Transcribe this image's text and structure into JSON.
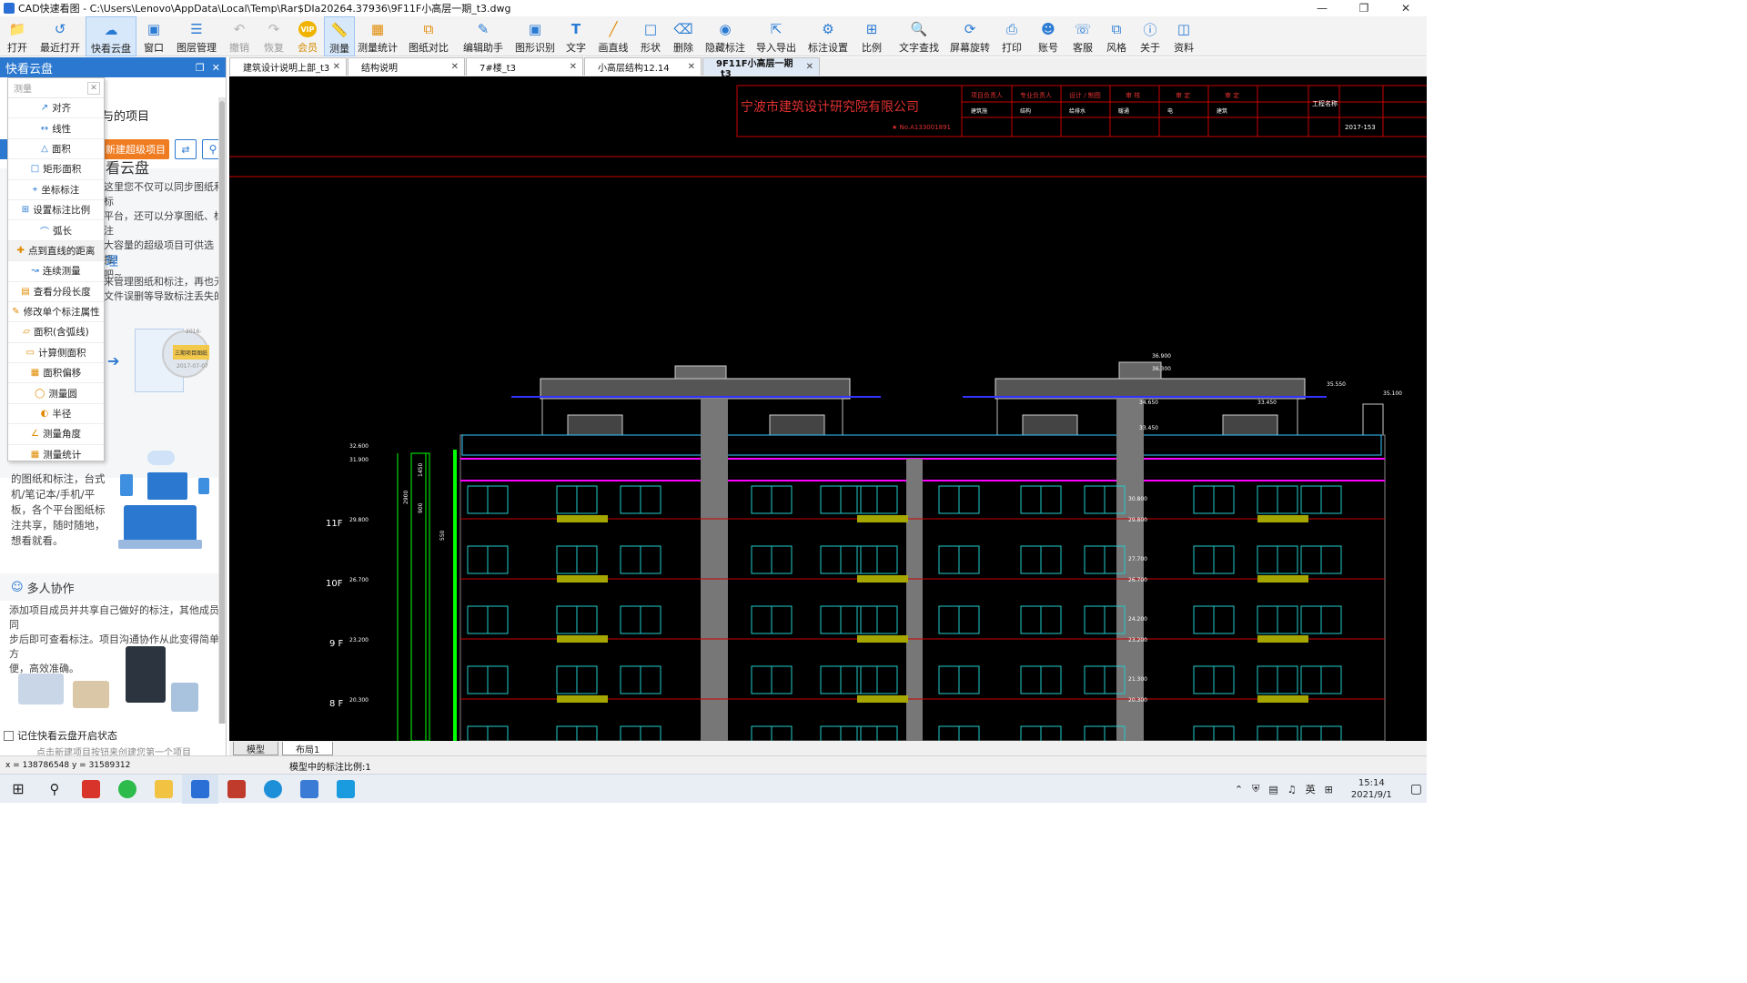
{
  "window": {
    "title": "CAD快速看图 - C:\\Users\\Lenovo\\AppData\\Local\\Temp\\Rar$DIa20264.37936\\9F11F小高层一期_t3.dwg"
  },
  "toolbar": {
    "open": "打开",
    "recent": "最近打开",
    "cloud": "快看云盘",
    "window": "窗口",
    "layer": "图层管理",
    "undo": "撤销",
    "redo": "恢复",
    "vip": "会员",
    "vip_badge": "VIP",
    "measure": "测量",
    "measure_stat": "测量统计",
    "compare": "图纸对比",
    "edit_assist": "编辑助手",
    "shape_recog": "图形识别",
    "text": "文字",
    "line": "画直线",
    "shape": "形状",
    "delete": "删除",
    "hide_annot": "隐藏标注",
    "import_export": "导入导出",
    "annot_settings": "标注设置",
    "scale": "比例",
    "text_search": "文字查找",
    "screen_rotate": "屏幕旋转",
    "print": "打印",
    "account": "账号",
    "service": "客服",
    "style": "风格",
    "about": "关于",
    "materials": "资料"
  },
  "sidepanel": {
    "title": "快看云盘",
    "my_projects": "与的项目",
    "new_project": "新建超级项目",
    "section1_title": "看云盘",
    "section1_text": [
      "这里您不仅可以同步图纸和标",
      "平台，还可以分享图纸、标注",
      "大容量的超级项目可供选择！",
      "吧~"
    ],
    "section2_title": "理",
    "section2_text": [
      "来管理图纸和标注，再也无",
      "文件误删等导致标注丢失的"
    ],
    "illus_date1": "2016-",
    "illus_label": "三期项目图纸",
    "illus_date2": "2017-07-07",
    "section3_text": [
      "的图纸和标注，台式",
      "机/笔记本/手机/平",
      "板，各个平台图纸标",
      "注共享，随时随地，",
      "想看就看。"
    ],
    "collab_title": "多人协作",
    "collab_text": [
      "添加项目成员并共享自己做好的标注，其他成员同",
      "步后即可查看标注。项目沟通协作从此变得简单方",
      "便，高效准确。"
    ],
    "remember": "记住快看云盘开启状态",
    "hint": "点击新建项目按钮来创建您第一个项目"
  },
  "measure_menu": {
    "header": "测量",
    "items": [
      "对齐",
      "线性",
      "面积",
      "矩形面积",
      "坐标标注",
      "设置标注比例",
      "弧长",
      "点到直线的距离",
      "连续测量",
      "查看分段长度",
      "修改单个标注属性",
      "面积(含弧线)",
      "计算侧面积",
      "面积偏移",
      "测量圆",
      "半径",
      "测量角度",
      "测量统计"
    ]
  },
  "tabs": [
    "建筑设计说明上部_t3",
    "结构说明",
    "7#楼_t3",
    "小高层结构12.14",
    "9F11F小高层一期_t3"
  ],
  "drawing": {
    "company": "宁波市建筑设计研究院有限公司",
    "cert": "★ No.A133001891",
    "project_no": "2017-153",
    "header_cells": [
      "项目负责人",
      "专业负责人",
      "设计 / 制图",
      "审 核",
      "审 定",
      "审 定"
    ],
    "header_row2": [
      "建筑施",
      "结构",
      "给排水",
      "暖通",
      "电",
      "建筑"
    ],
    "tbl_label": "工程名称",
    "floors": [
      {
        "label": "11F",
        "elev": "29.800"
      },
      {
        "label": "10F",
        "elev": "26.700"
      },
      {
        "label": "9 F",
        "elev": "23.200"
      },
      {
        "label": "8 F",
        "elev": "20.300"
      }
    ],
    "top_elevs": [
      "32.600",
      "31.900"
    ],
    "roof_elevs": [
      "36.900",
      "36.300",
      "35.550",
      "35.100",
      "34.650",
      "33.450",
      "33.450"
    ],
    "mid_elevs": [
      "30.800",
      "29.800",
      "27.700",
      "26.700",
      "24.200",
      "23.200",
      "21.300",
      "20.300"
    ],
    "dims": [
      "2900",
      "1450",
      "900",
      "550"
    ]
  },
  "bottom_tabs": [
    "模型",
    "布局1"
  ],
  "status": {
    "coords": "x = 138786548  y = 31589312",
    "scale": "模型中的标注比例:1"
  },
  "taskbar": {
    "ime": "英",
    "time": "15:14",
    "date": "2021/9/1"
  },
  "colors": {
    "accent": "#2b78d0",
    "orange": "#f07c22",
    "canvas": "#000000"
  }
}
